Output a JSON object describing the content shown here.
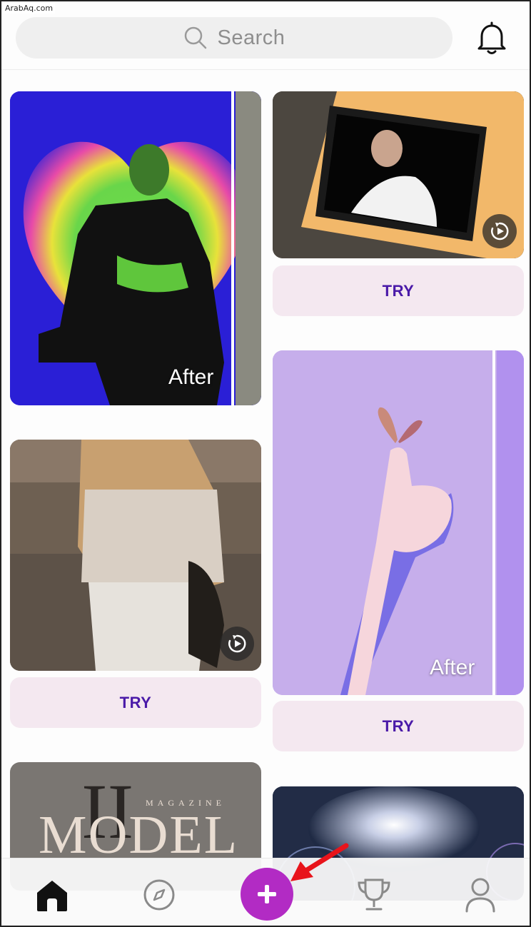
{
  "watermark": "ArabAq.com",
  "search": {
    "placeholder": "Search"
  },
  "cards": {
    "heart": {
      "label": "After"
    },
    "frame": {
      "try_label": "TRY"
    },
    "street": {
      "try_label": "TRY"
    },
    "butterfly": {
      "label": "After",
      "try_label": "TRY"
    },
    "magazine": {
      "title": "MODEL",
      "roman": "II",
      "subtitle": "MAGAZINE"
    }
  },
  "nav": {
    "items": [
      "home-icon",
      "explore-icon",
      "create-icon",
      "challenges-icon",
      "profile-icon"
    ],
    "accent": "#b22bc4"
  },
  "colors": {
    "try_bg": "#f4e8f0",
    "try_text": "#4a1aa8",
    "annotation_arrow": "#e8141b"
  }
}
